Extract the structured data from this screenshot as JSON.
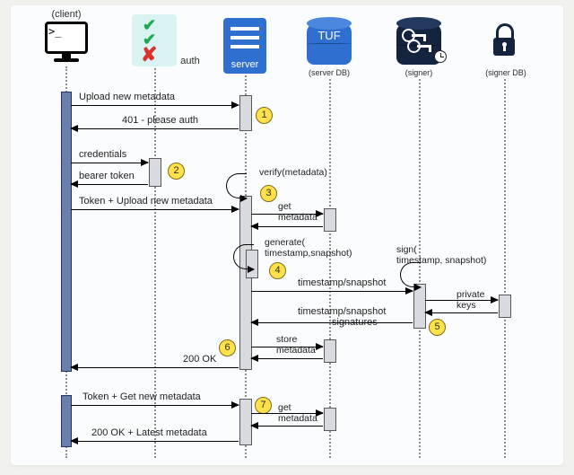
{
  "actors": {
    "client": {
      "label": "(client)"
    },
    "auth": {
      "label": "auth"
    },
    "server": {
      "label": "server"
    },
    "tuf": {
      "label": "TUF",
      "sub": "(server DB)"
    },
    "signer": {
      "label": "(signer)"
    },
    "signer_db": {
      "label": "(signer DB)"
    }
  },
  "steps": {
    "s1": "1",
    "s2": "2",
    "s3": "3",
    "s4": "4",
    "s5": "5",
    "s6": "6",
    "s7": "7"
  },
  "msgs": {
    "upload": "Upload new metadata",
    "resp_401": "401 - please auth",
    "creds": "credentials",
    "bearer": "bearer token",
    "token_upload": "Token + Upload new metadata",
    "verify": "verify(metadata)",
    "get_meta_1": "get",
    "get_meta_2": "metadata",
    "generate_1": "generate(",
    "generate_2": "timestamp,snapshot)",
    "sign_1": "sign(",
    "sign_2": "timestamp, snapshot)",
    "ts_snap": "timestamp/snapshot",
    "ts_snap_sig_1": "timestamp/snapshot",
    "ts_snap_sig_2": "signatures",
    "priv_1": "private",
    "priv_2": "keys",
    "store_1": "store",
    "store_2": "metadata",
    "ok": "200 OK",
    "token_get": "Token + Get new metadata",
    "get2_1": "get",
    "get2_2": "metadata",
    "ok_latest": "200 OK + Latest metadata"
  }
}
